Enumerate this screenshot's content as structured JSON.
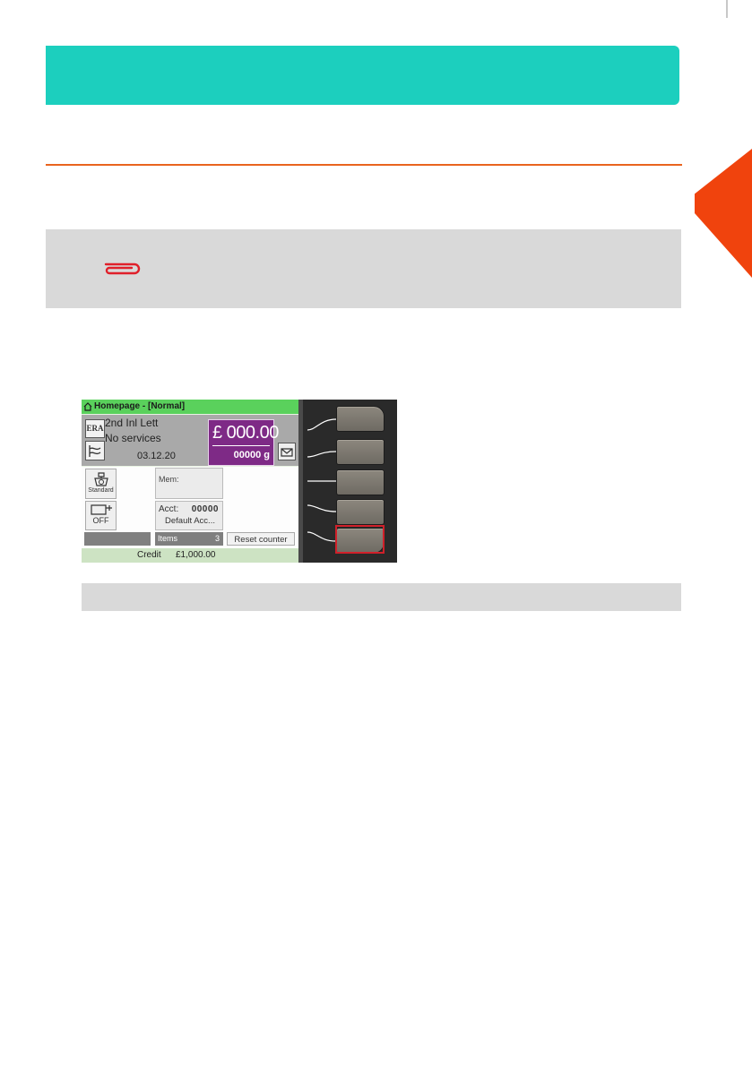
{
  "device_screen": {
    "title": "Homepage - [Normal]",
    "era_label": "ERA",
    "service": "2nd Inl Lett",
    "services": "No services",
    "date": "03.12.20",
    "price": "£ 000.00",
    "weight": "00000 g",
    "standard_label": "Standard",
    "off_label": "OFF",
    "mem_label": "Mem:",
    "acct_label": "Acct:",
    "acct_number": "00000",
    "acct_name": "Default Acc...",
    "items_label": "Items",
    "items_value": "3",
    "reset_label": "Reset counter",
    "credit_label": "Credit",
    "credit_value": "£1,000.00"
  },
  "colors": {
    "header_band": "#1ccfbe",
    "accent_rule": "#e9641f",
    "side_tab": "#f0430d",
    "note_box": "#d9d9d9",
    "price_box": "#7e2a86",
    "titlebar": "#5ad15c",
    "highlight": "#d0202a"
  },
  "icons": [
    "paperclip-icon",
    "home-icon",
    "wave-icon",
    "envelope-icon",
    "scale-icon",
    "card-reader-icon"
  ]
}
